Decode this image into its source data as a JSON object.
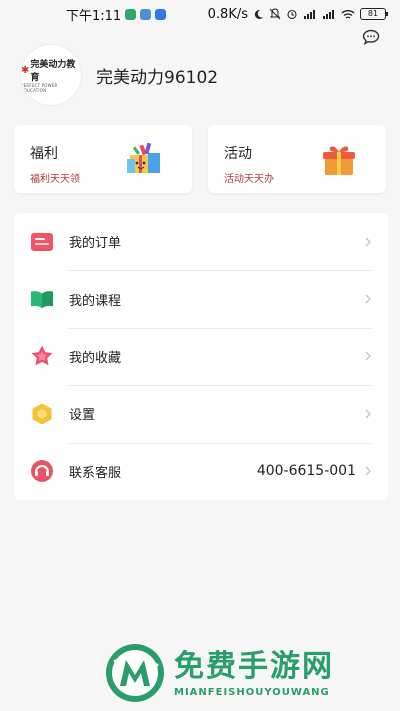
{
  "status_bar": {
    "time": "下午1:11",
    "speed": "0.8K/s",
    "battery": "81"
  },
  "profile": {
    "logo_text": "完美动力教育",
    "logo_subtext": "PERFECT POWER EDUCATION",
    "username": "完美动力96102"
  },
  "cards": [
    {
      "title": "福利",
      "subtitle": "福利天天领",
      "icon": "gift-boxes-icon"
    },
    {
      "title": "活动",
      "subtitle": "活动天天办",
      "icon": "gift-icon"
    }
  ],
  "menu": [
    {
      "label": "我的订单",
      "icon": "order-icon",
      "color": "#ef5563"
    },
    {
      "label": "我的课程",
      "icon": "book-icon",
      "color": "#2bb673"
    },
    {
      "label": "我的收藏",
      "icon": "star-icon",
      "color": "#e9506a"
    },
    {
      "label": "设置",
      "icon": "hexagon-settings-icon",
      "color": "#f5c233"
    },
    {
      "label": "联系客服",
      "icon": "service-icon",
      "color": "#e8556b",
      "value": "400-6615-001"
    }
  ],
  "watermark": {
    "cn": "免费手游网",
    "en": "MIANFEISHOUYOUWANG"
  },
  "colors": {
    "accent_red": "#b13a3a",
    "watermark_green": "#2a9d6d",
    "background": "#f6f6f7"
  }
}
